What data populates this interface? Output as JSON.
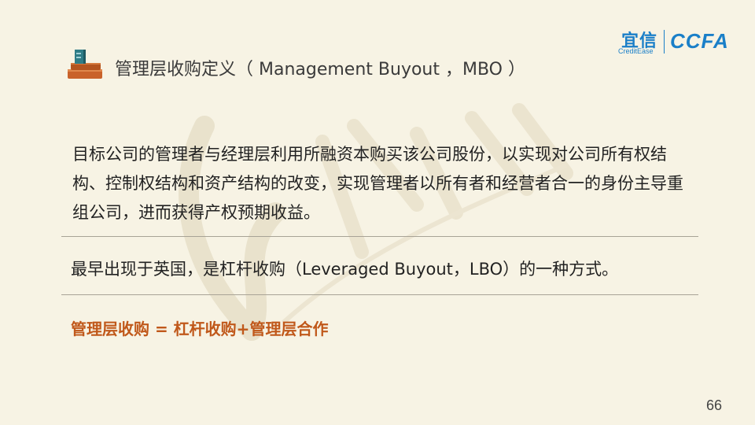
{
  "slide": {
    "title": "管理层收购定义（ Management Buyout ，MBO ）",
    "title_icon": "stacked-books-icon",
    "logo": {
      "cn": "宜信",
      "en": "CreditEase",
      "ccfa": "CCFA"
    },
    "paragraph": "目标公司的管理者与经理层利用所融资本购买该公司股份，以实现对公司所有权结构、控制权结构和资产结构的改变，实现管理者以所有者和经营者合一的身份主导重组公司，进而获得产权预期收益。",
    "line2": "最早出现于英国，是杠杆收购（Leveraged Buyout，LBO）的一种方式。",
    "formula": "管理层收购 = 杠杆收购+管理层合作",
    "page_number": "66",
    "colors": {
      "background": "#f7f3e4",
      "accent_orange": "#c0581a",
      "logo_blue": "#1a7fc8"
    }
  }
}
